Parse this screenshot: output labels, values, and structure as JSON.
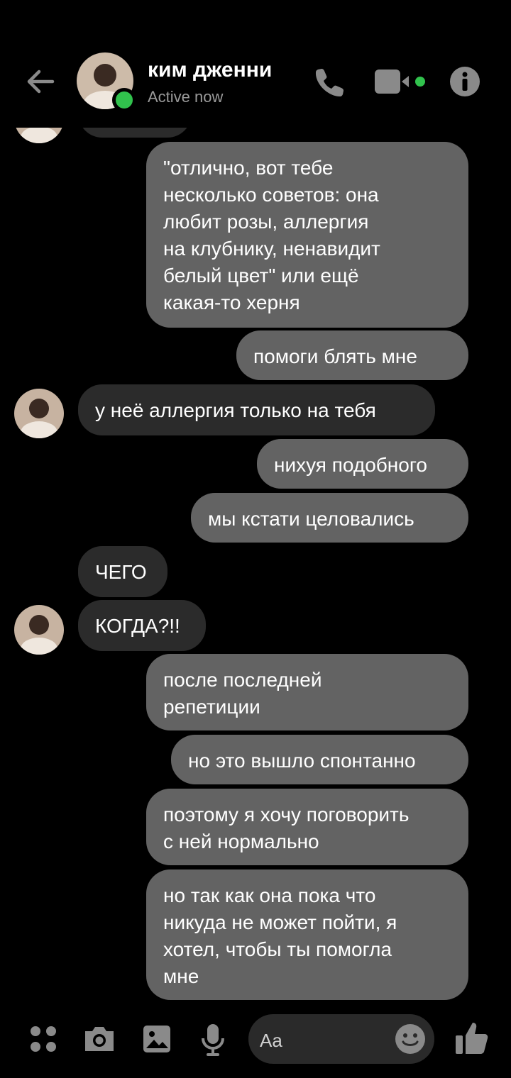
{
  "header": {
    "contact_name": "ким дженни",
    "status": "Active now",
    "status_color": "#31c24d"
  },
  "messages": [
    {
      "side": "out",
      "text": "\"отлично, вот тебе\nнесколько советов: она\nлюбит розы, аллергия\nна клубнику, ненавидит\nбелый цвет\" или ещё\nкакая-то херня"
    },
    {
      "side": "out",
      "text": "помоги блять мне"
    },
    {
      "side": "in",
      "text": "у неё аллергия только на тебя"
    },
    {
      "side": "out",
      "text": "нихуя подобного"
    },
    {
      "side": "out",
      "text": "мы кстати целовались"
    },
    {
      "side": "in",
      "text": "ЧЕГО"
    },
    {
      "side": "in",
      "text": "КОГДА?!!"
    },
    {
      "side": "out",
      "text": "после последней\nрепетиции"
    },
    {
      "side": "out",
      "text": "но это вышло спонтанно"
    },
    {
      "side": "out",
      "text": "поэтому я хочу поговорить\nс ней нормально"
    },
    {
      "side": "out",
      "text": "но так как она пока что\nникуда не может пойти, я\nхотел, чтобы ты помогла\nмне"
    }
  ],
  "composer": {
    "placeholder": "Aa"
  },
  "icons": {
    "back": "back-arrow-icon",
    "call": "phone-icon",
    "video": "video-camera-icon",
    "info": "info-icon",
    "menu": "four-dots-icon",
    "camera": "camera-icon",
    "gallery": "image-icon",
    "mic": "microphone-icon",
    "emoji": "emoji-icon",
    "like": "thumbs-up-icon"
  },
  "colors": {
    "background": "#000000",
    "outgoing_bubble": "#636363",
    "incoming_bubble": "#2b2b2b",
    "icon_gray": "#8a8a8a"
  }
}
